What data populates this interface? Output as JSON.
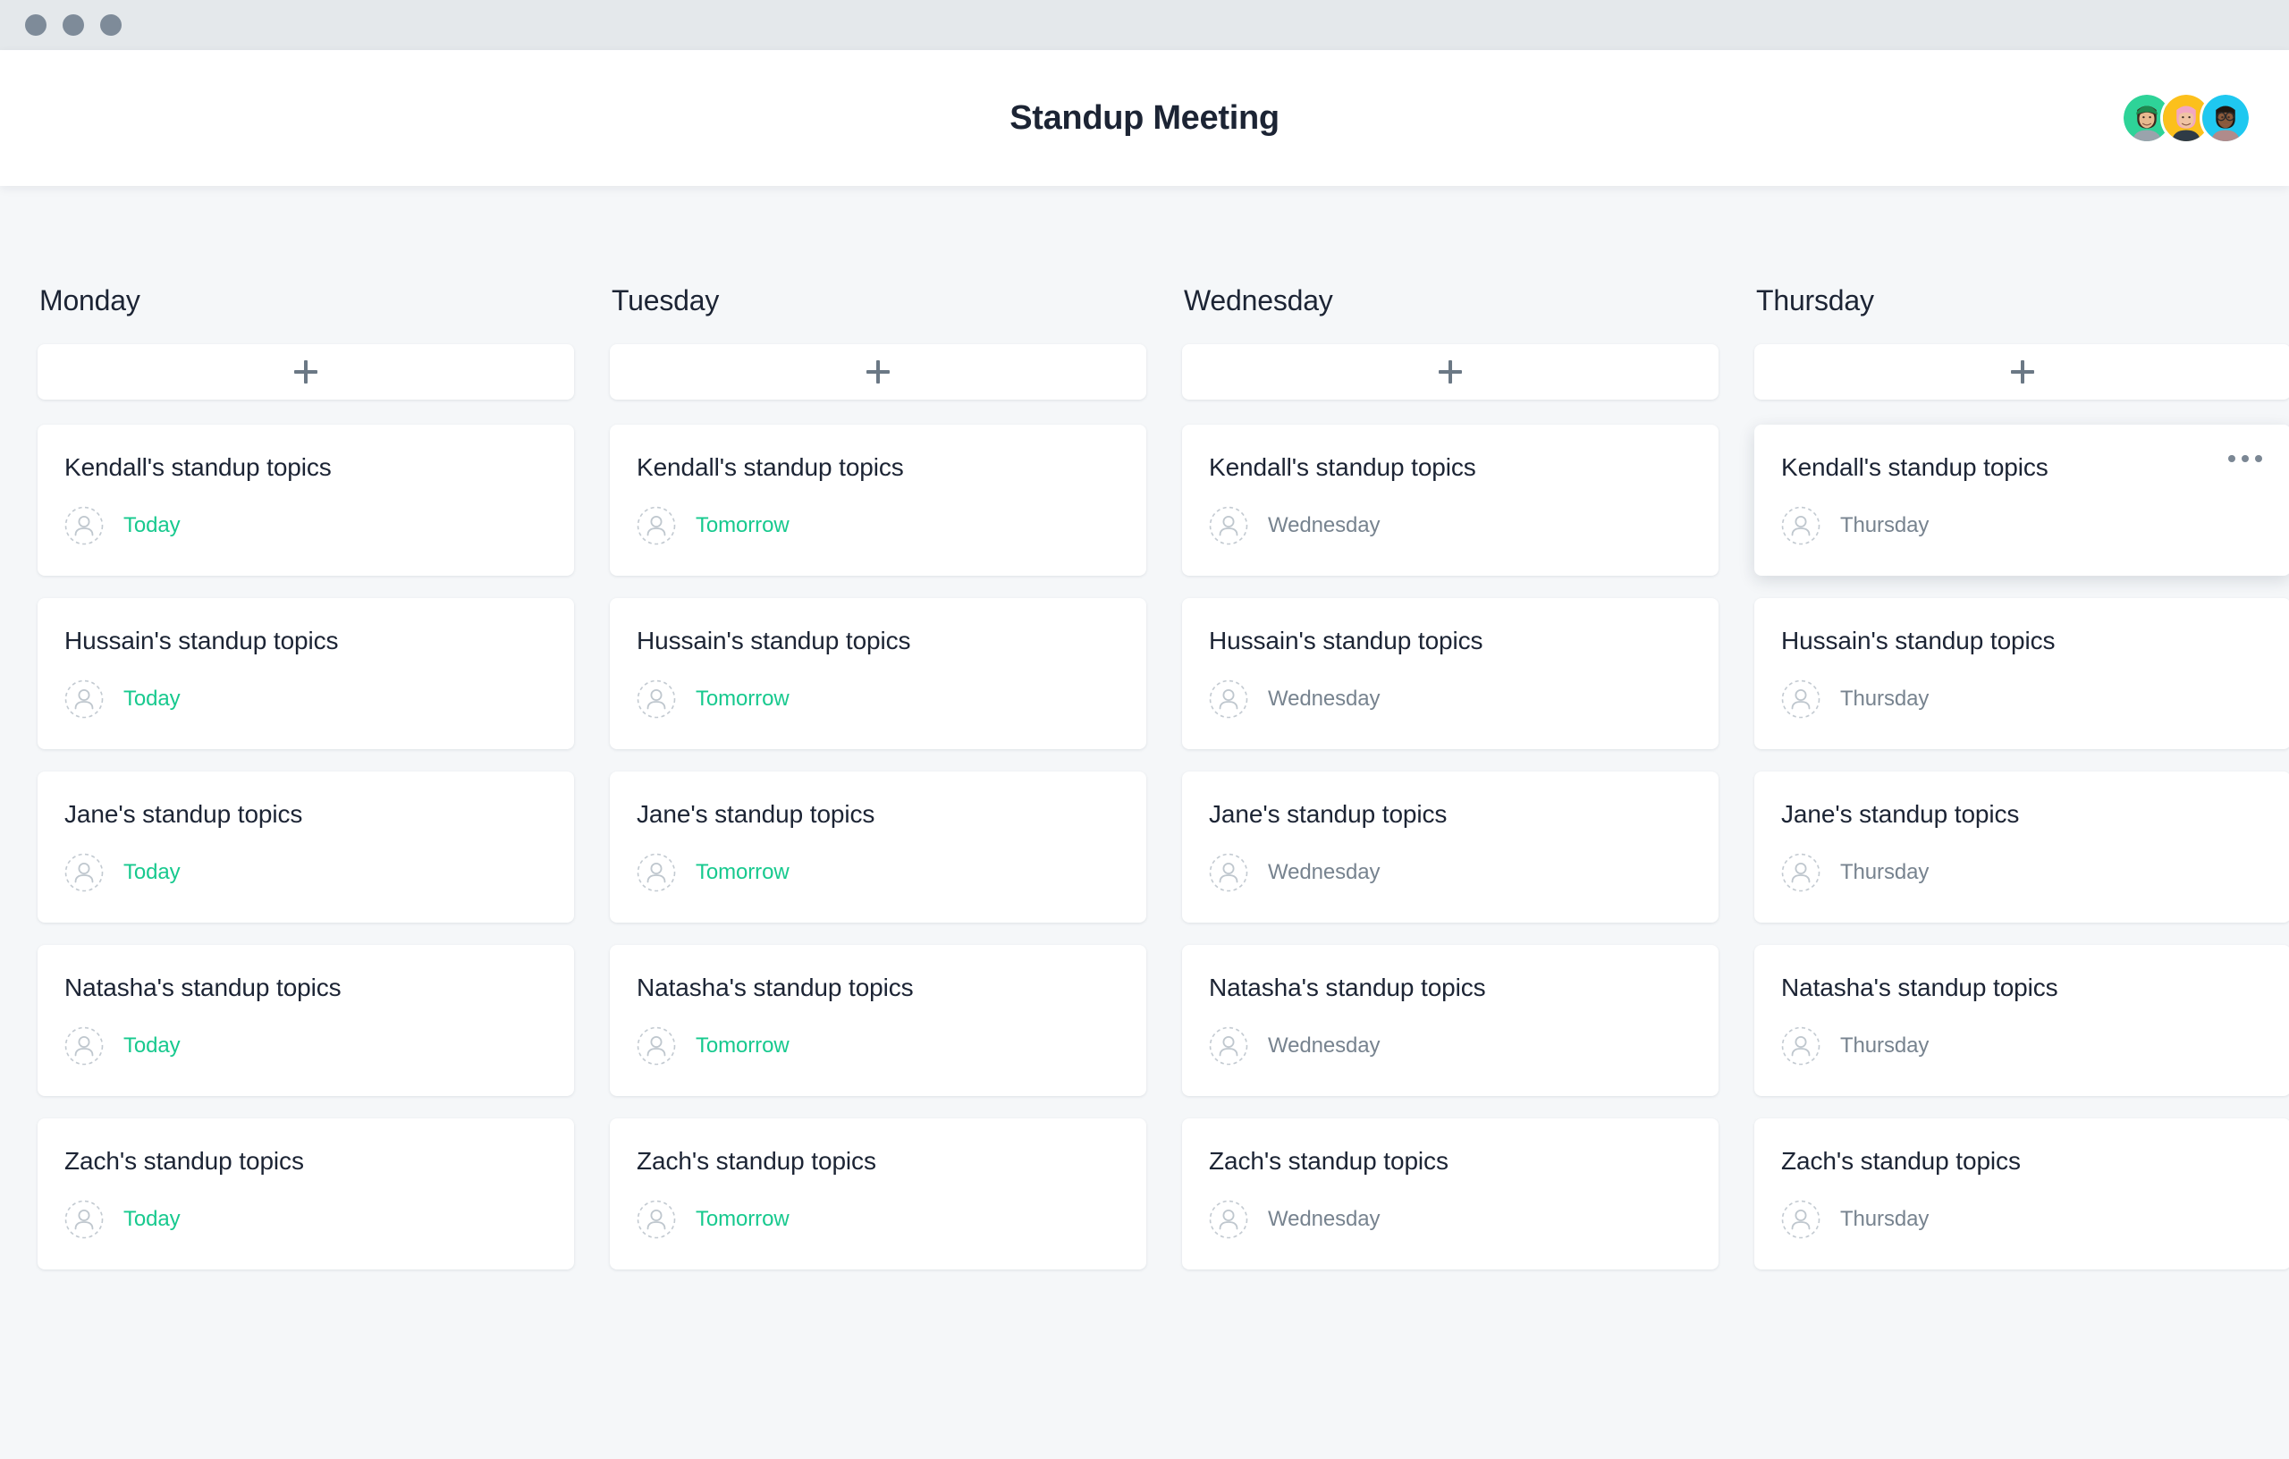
{
  "window": {
    "traffic_lights": [
      "close",
      "minimize",
      "maximize"
    ]
  },
  "header": {
    "title": "Standup Meeting",
    "avatars": [
      {
        "name": "avatar-kendall",
        "bg": "#2ed398",
        "skin": "#e7b98f",
        "hair": "#3c2a1e",
        "shirt": "#9aa3ac",
        "accessory": "cap",
        "accessory_color": "#1d8a4f"
      },
      {
        "name": "avatar-jane",
        "bg": "#fcc01c",
        "skin": "#f0c3a4",
        "hair": "#f2a7c3",
        "shirt": "#2f3b46",
        "accessory": "none",
        "accessory_color": "#000000"
      },
      {
        "name": "avatar-zach",
        "bg": "#1fc8f0",
        "skin": "#8a5a3b",
        "hair": "#1e1812",
        "shirt": "#b08b8b",
        "accessory": "glasses",
        "accessory_color": "#2b2b2b"
      }
    ]
  },
  "board": {
    "add_card_label": "+",
    "columns": [
      {
        "id": "monday",
        "title": "Monday",
        "cards": [
          {
            "title": "Kendall's standup topics",
            "due": "Today",
            "due_style": "accent",
            "menu": false,
            "hovered": false
          },
          {
            "title": "Hussain's standup topics",
            "due": "Today",
            "due_style": "accent",
            "menu": false,
            "hovered": false
          },
          {
            "title": "Jane's standup topics",
            "due": "Today",
            "due_style": "accent",
            "menu": false,
            "hovered": false
          },
          {
            "title": "Natasha's standup topics",
            "due": "Today",
            "due_style": "accent",
            "menu": false,
            "hovered": false
          },
          {
            "title": "Zach's standup topics",
            "due": "Today",
            "due_style": "accent",
            "menu": false,
            "hovered": false
          }
        ]
      },
      {
        "id": "tuesday",
        "title": "Tuesday",
        "cards": [
          {
            "title": "Kendall's standup topics",
            "due": "Tomorrow",
            "due_style": "accent",
            "menu": false,
            "hovered": false
          },
          {
            "title": "Hussain's standup topics",
            "due": "Tomorrow",
            "due_style": "accent",
            "menu": false,
            "hovered": false
          },
          {
            "title": "Jane's standup topics",
            "due": "Tomorrow",
            "due_style": "accent",
            "menu": false,
            "hovered": false
          },
          {
            "title": "Natasha's standup topics",
            "due": "Tomorrow",
            "due_style": "accent",
            "menu": false,
            "hovered": false
          },
          {
            "title": "Zach's standup topics",
            "due": "Tomorrow",
            "due_style": "accent",
            "menu": false,
            "hovered": false
          }
        ]
      },
      {
        "id": "wednesday",
        "title": "Wednesday",
        "cards": [
          {
            "title": "Kendall's standup topics",
            "due": "Wednesday",
            "due_style": "muted",
            "menu": false,
            "hovered": false
          },
          {
            "title": "Hussain's standup topics",
            "due": "Wednesday",
            "due_style": "muted",
            "menu": false,
            "hovered": false
          },
          {
            "title": "Jane's standup topics",
            "due": "Wednesday",
            "due_style": "muted",
            "menu": false,
            "hovered": false
          },
          {
            "title": "Natasha's standup topics",
            "due": "Wednesday",
            "due_style": "muted",
            "menu": false,
            "hovered": false
          },
          {
            "title": "Zach's standup topics",
            "due": "Wednesday",
            "due_style": "muted",
            "menu": false,
            "hovered": false
          }
        ]
      },
      {
        "id": "thursday",
        "title": "Thursday",
        "cards": [
          {
            "title": "Kendall's standup topics",
            "due": "Thursday",
            "due_style": "muted",
            "menu": true,
            "hovered": true
          },
          {
            "title": "Hussain's standup topics",
            "due": "Thursday",
            "due_style": "muted",
            "menu": false,
            "hovered": false
          },
          {
            "title": "Jane's standup topics",
            "due": "Thursday",
            "due_style": "muted",
            "menu": false,
            "hovered": false
          },
          {
            "title": "Natasha's standup topics",
            "due": "Thursday",
            "due_style": "muted",
            "menu": false,
            "hovered": false
          },
          {
            "title": "Zach's standup topics",
            "due": "Thursday",
            "due_style": "muted",
            "menu": false,
            "hovered": false
          }
        ]
      }
    ]
  },
  "colors": {
    "accent_green": "#17c98e",
    "muted_text": "#77838f",
    "title_text": "#1c2434",
    "board_bg": "#f5f7f9",
    "card_bg": "#ffffff",
    "titlebar_bg": "#e4e8eb",
    "traffic_dot": "#7e8b99"
  }
}
